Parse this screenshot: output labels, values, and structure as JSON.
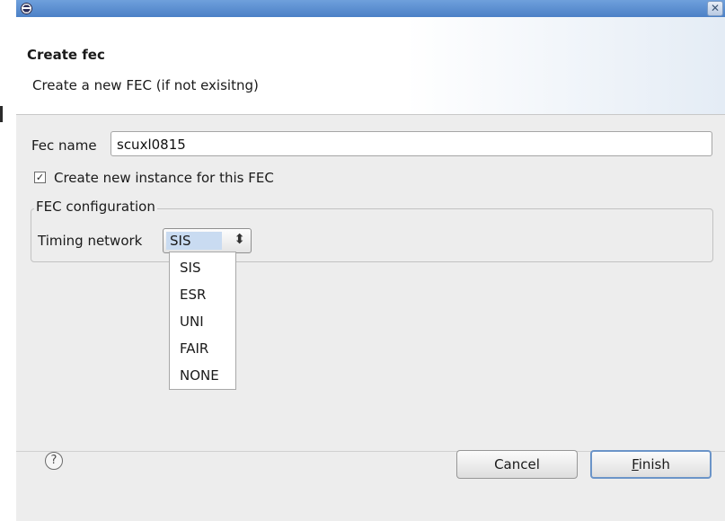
{
  "titlebar": {
    "close_glyph": "✕",
    "app_icon": "eclipse-icon"
  },
  "header": {
    "title": "Create fec",
    "description": "Create a new FEC (if not exisitng)"
  },
  "form": {
    "fec_name_label": "Fec name",
    "fec_name_value": "scuxl0815",
    "create_instance_checked": true,
    "create_instance_check_glyph": "✓",
    "create_instance_label": "Create new instance for this FEC",
    "group_title": "FEC configuration",
    "timing_label": "Timing network",
    "timing_selected": "SIS",
    "timing_arrows_glyph": "⬍",
    "timing_options": [
      "SIS",
      "ESR",
      "UNI",
      "FAIR",
      "NONE"
    ]
  },
  "footer": {
    "help_glyph": "?",
    "cancel_label": "Cancel",
    "finish_mnemonic": "F",
    "finish_rest": "inish"
  },
  "colors": {
    "titlebar": "#4b80c6",
    "dialog_bg": "#ededed",
    "selection": "#c9dbf1",
    "default_button_border": "#6b94c8"
  }
}
